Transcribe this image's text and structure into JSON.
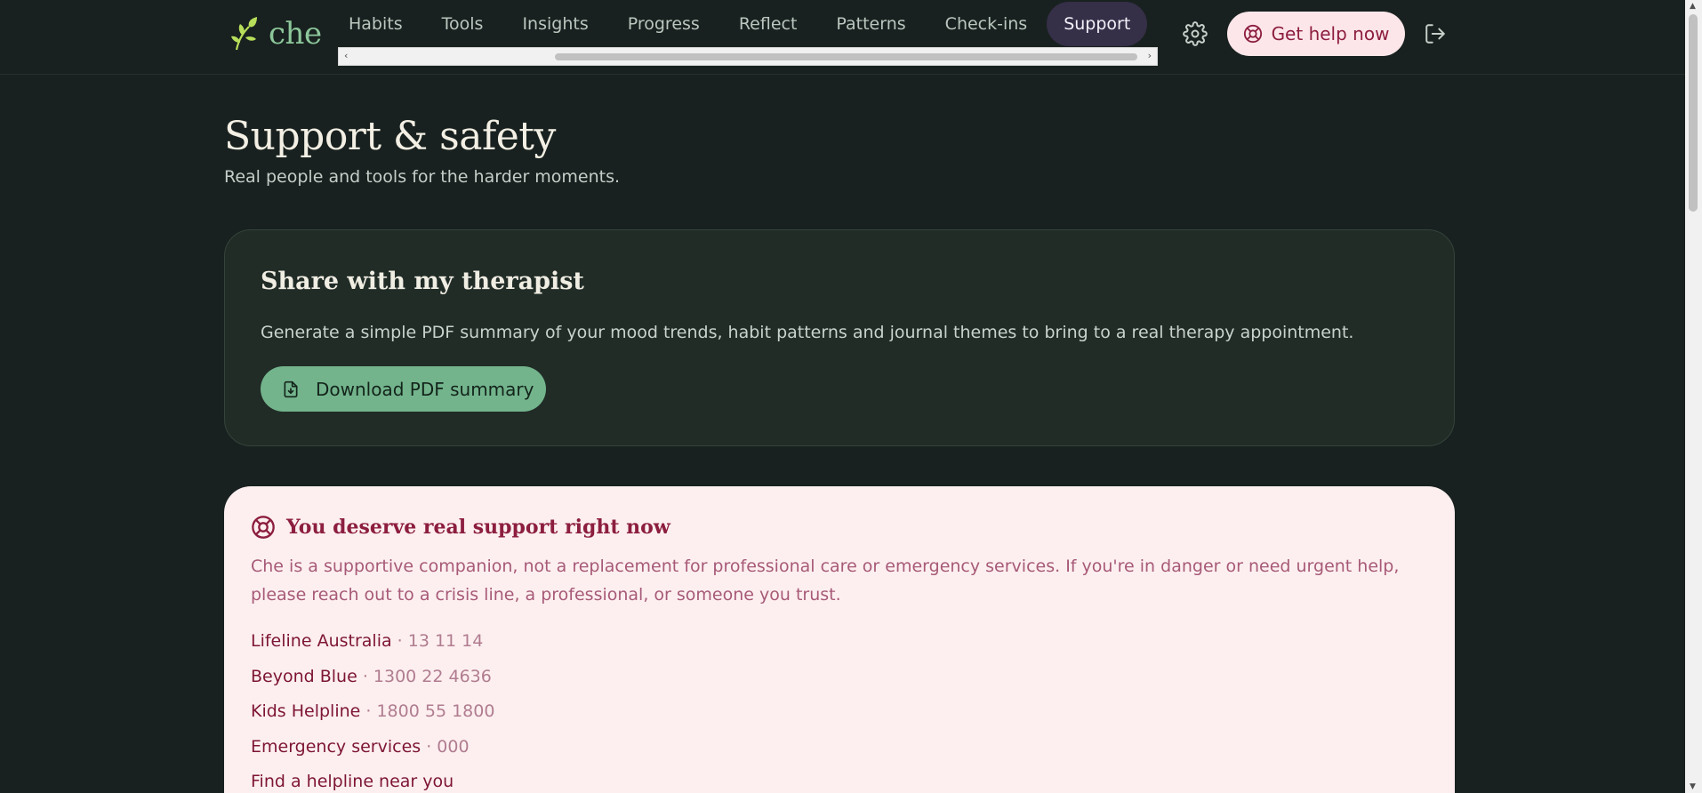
{
  "app": {
    "logo_text": "che"
  },
  "nav": {
    "items": [
      {
        "label": "Habits"
      },
      {
        "label": "Tools"
      },
      {
        "label": "Insights"
      },
      {
        "label": "Progress"
      },
      {
        "label": "Reflect"
      },
      {
        "label": "Patterns"
      },
      {
        "label": "Check-ins"
      },
      {
        "label": "Support"
      }
    ],
    "active": "Support"
  },
  "header": {
    "help_button": "Get help now"
  },
  "page": {
    "title": "Support & safety",
    "subtitle": "Real people and tools for the harder moments."
  },
  "therapist_card": {
    "title": "Share with my therapist",
    "description": "Generate a simple PDF summary of your mood trends, habit patterns and journal themes to bring to a real therapy appointment.",
    "button": "Download PDF summary"
  },
  "crisis_card": {
    "title": "You deserve real support right now",
    "text": "Che is a supportive companion, not a replacement for professional care or emergency services. If you're in danger or need urgent help, please reach out to a crisis line, a professional, or someone you trust.",
    "lines": [
      {
        "name": "Lifeline Australia",
        "number": " · 13 11 14"
      },
      {
        "name": "Beyond Blue",
        "number": " · 1300 22 4636"
      },
      {
        "name": "Kids Helpline",
        "number": " · 1800 55 1800"
      },
      {
        "name": "Emergency services",
        "number": " · 000"
      }
    ],
    "find_link": "Find a helpline near you"
  },
  "colors": {
    "background": "#18211f",
    "accent_green": "#73b48c",
    "active_nav": "#362f48",
    "crisis_bg": "#fdeff0",
    "crisis_text": "#8c1e40"
  },
  "icons": [
    "leaf-logo-icon",
    "gear-icon",
    "lifebuoy-icon",
    "logout-icon",
    "file-download-icon"
  ]
}
